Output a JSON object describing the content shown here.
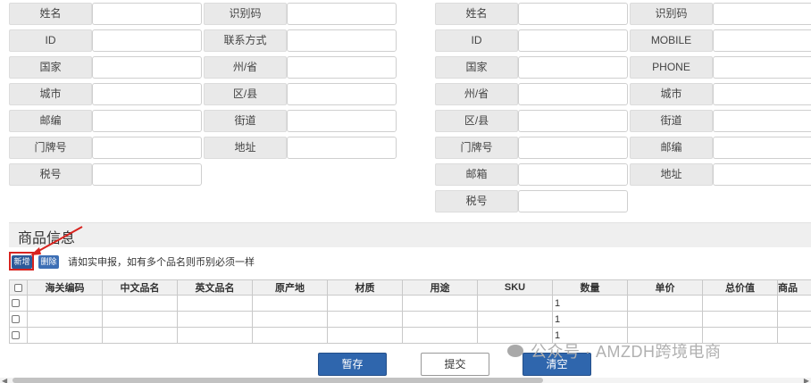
{
  "left_form": {
    "rows": [
      [
        "姓名",
        "识别码"
      ],
      [
        "ID",
        "联系方式"
      ],
      [
        "国家",
        "州/省"
      ],
      [
        "城市",
        "区/县"
      ],
      [
        "邮编",
        "街道"
      ],
      [
        "门牌号",
        "地址"
      ],
      [
        "税号",
        ""
      ]
    ]
  },
  "right_form": {
    "rows": [
      [
        "姓名",
        "识别码"
      ],
      [
        "ID",
        "MOBILE"
      ],
      [
        "国家",
        "PHONE"
      ],
      [
        "州/省",
        "城市"
      ],
      [
        "区/县",
        "街道"
      ],
      [
        "门牌号",
        "邮编"
      ],
      [
        "邮箱",
        "地址"
      ],
      [
        "税号",
        ""
      ]
    ]
  },
  "goods_section": {
    "title": "商品信息",
    "add_label": "新增",
    "delete_label": "删除",
    "hint": "请如实申报，如有多个品名则币别必须一样"
  },
  "goods_table": {
    "columns": [
      "海关编码",
      "中文品名",
      "英文品名",
      "原产地",
      "材质",
      "用途",
      "SKU",
      "数量",
      "单价",
      "总价值",
      "商品"
    ],
    "rows": [
      [
        "",
        "",
        "",
        "",
        "",
        "",
        "",
        "1",
        "",
        "",
        ""
      ],
      [
        "",
        "",
        "",
        "",
        "",
        "",
        "",
        "1",
        "",
        "",
        ""
      ],
      [
        "",
        "",
        "",
        "",
        "",
        "",
        "",
        "1",
        "",
        "",
        ""
      ]
    ]
  },
  "actions": {
    "save_label": "暂存",
    "submit_label": "提交",
    "clear_label": "清空"
  },
  "watermark": "公众号 · AMZDH跨境电商",
  "colors": {
    "primary": "#2f66ad",
    "annotation": "#d8231f",
    "label_bg": "#e9e9e9"
  }
}
